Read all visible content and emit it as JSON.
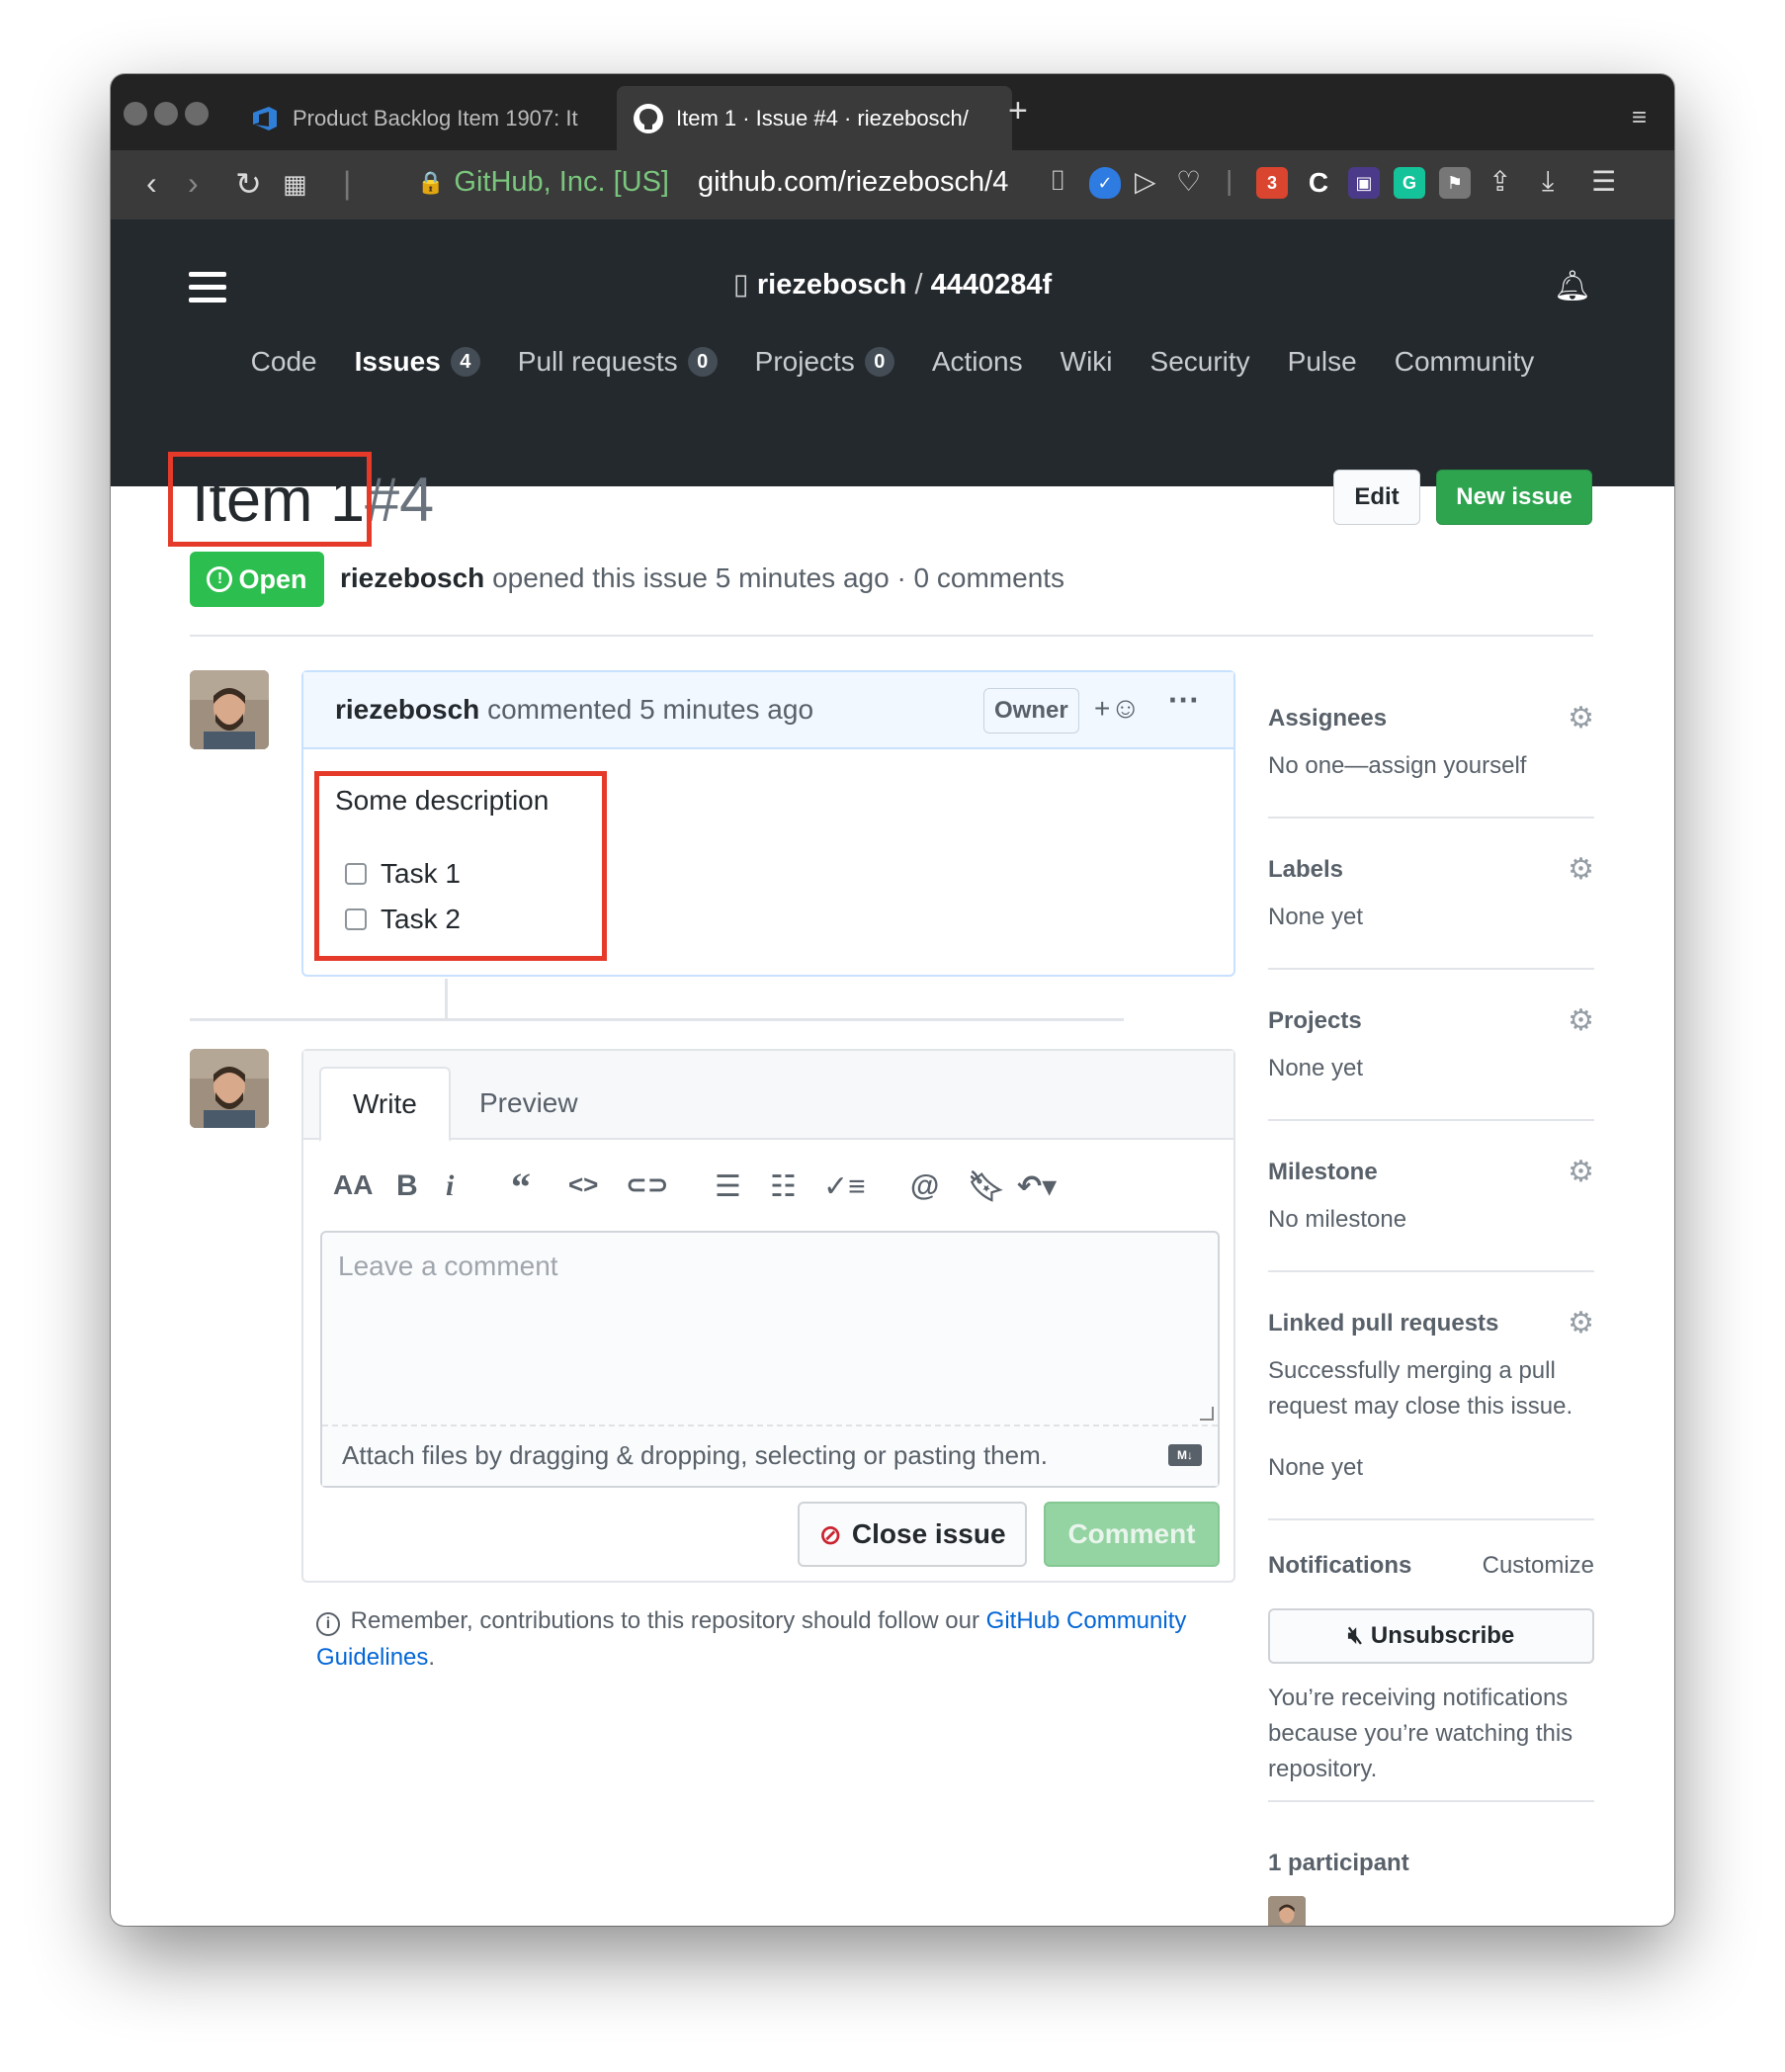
{
  "browser": {
    "tabs": [
      {
        "label": "Product Backlog Item 1907: It",
        "active": false
      },
      {
        "label": "Item 1 · Issue #4 · riezebosch/",
        "active": true
      }
    ],
    "new_tab": "+",
    "security_label": "GitHub, Inc. [US]",
    "url": "github.com/riezebosch/4",
    "ext_badge": "3"
  },
  "repo": {
    "owner": "riezebosch",
    "separator": "/",
    "name": "4440284f"
  },
  "nav": [
    {
      "label": "Code"
    },
    {
      "label": "Issues",
      "count": "4",
      "selected": true
    },
    {
      "label": "Pull requests",
      "count": "0"
    },
    {
      "label": "Projects",
      "count": "0"
    },
    {
      "label": "Actions"
    },
    {
      "label": "Wiki"
    },
    {
      "label": "Security"
    },
    {
      "label": "Pulse"
    },
    {
      "label": "Community"
    }
  ],
  "issue": {
    "title": "Item 1",
    "number": "#4",
    "edit_label": "Edit",
    "new_issue_label": "New issue",
    "state": "Open",
    "author": "riezebosch",
    "meta_text": "opened this issue 5 minutes ago · 0 comments"
  },
  "comment": {
    "author": "riezebosch",
    "time_text": "commented 5 minutes ago",
    "role_badge": "Owner",
    "reaction_label": "+",
    "description": "Some description",
    "tasks": [
      {
        "label": "Task 1",
        "checked": false
      },
      {
        "label": "Task 2",
        "checked": false
      }
    ]
  },
  "composer": {
    "tab_write": "Write",
    "tab_preview": "Preview",
    "placeholder": "Leave a comment",
    "attach_text": "Attach files by dragging & dropping, selecting or pasting them.",
    "markdown_badge": "M↓",
    "close_issue_label": "Close issue",
    "comment_label": "Comment",
    "remember_text": "Remember, contributions to this repository should follow our",
    "remember_link": "GitHub Community Guidelines",
    "remember_end": "."
  },
  "sidebar": {
    "assignees": {
      "heading": "Assignees",
      "value": "No one—assign yourself"
    },
    "labels": {
      "heading": "Labels",
      "value": "None yet"
    },
    "projects": {
      "heading": "Projects",
      "value": "None yet"
    },
    "milestone": {
      "heading": "Milestone",
      "value": "No milestone"
    },
    "linked": {
      "heading": "Linked pull requests",
      "note": "Successfully merging a pull request may close this issue.",
      "value": "None yet"
    },
    "notifications": {
      "heading": "Notifications",
      "customize": "Customize",
      "button": "Unsubscribe",
      "note": "You’re receiving notifications because you’re watching this repository."
    },
    "participants": {
      "heading": "1 participant"
    }
  },
  "colors": {
    "open_green": "#2cbe4e",
    "new_issue_green": "#2ea44f",
    "link_blue": "#0366d6",
    "highlight_red": "#e53a2a",
    "header_dark": "#24292e"
  }
}
